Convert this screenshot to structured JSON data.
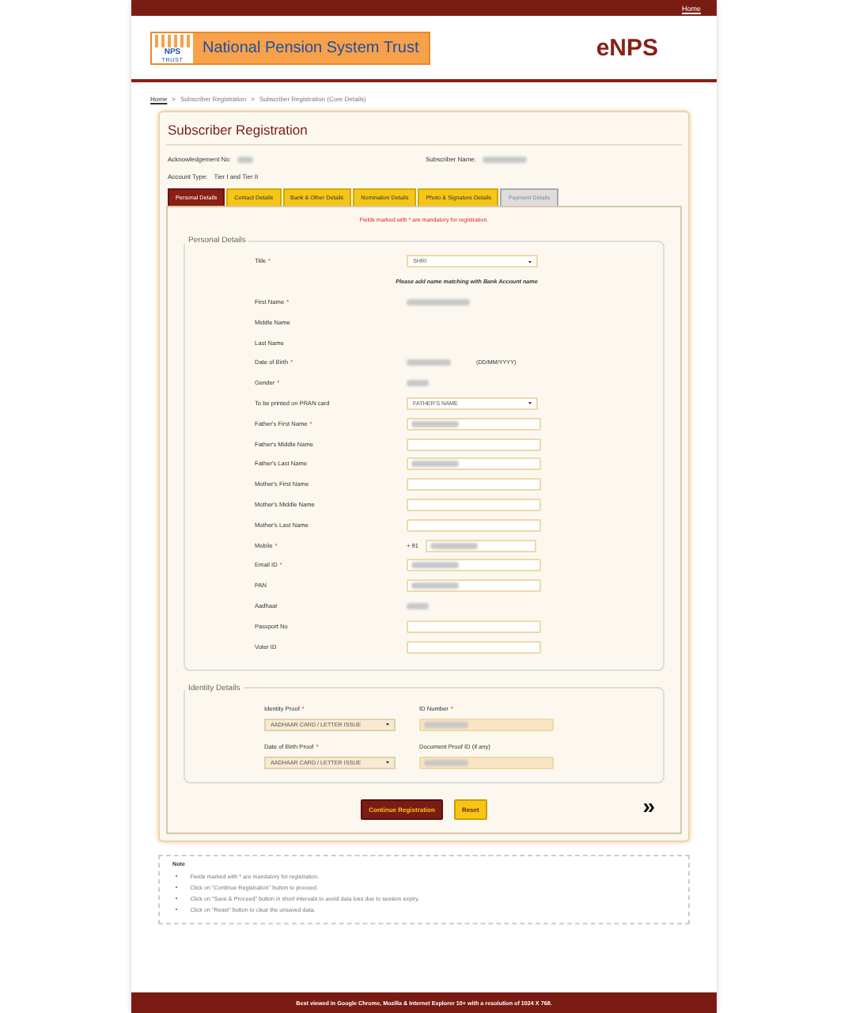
{
  "top_bar": {
    "link": "Home"
  },
  "header": {
    "logo_mark": "NPS",
    "logo_sub": "TRUST",
    "org_name": "National Pension System Trust",
    "brand": "eNPS"
  },
  "breadcrumb": [
    {
      "label": "Home",
      "link": true
    },
    {
      "label": "Subscriber Registration",
      "link": false
    },
    {
      "label": "Subscriber Registration (Core Details)",
      "link": false
    }
  ],
  "breadcrumb_separator": ">",
  "form": {
    "title": "Subscriber Registration",
    "info": [
      {
        "label": "Acknowledgement No:",
        "redacted": true
      },
      {
        "label": "Subscriber Name:",
        "redacted": true
      },
      {
        "label": "Account Type:",
        "value": "Tier I and Tier II"
      }
    ],
    "tabs": [
      {
        "label": "Personal Details",
        "selected": true,
        "disabled": false
      },
      {
        "label": "Contact Details",
        "selected": false,
        "disabled": false
      },
      {
        "label": "Bank & Other Details",
        "selected": false,
        "disabled": false
      },
      {
        "label": "Nomination Details",
        "selected": false,
        "disabled": false
      },
      {
        "label": "Photo & Signature Details",
        "selected": false,
        "disabled": false
      },
      {
        "label": "Payment Details",
        "selected": false,
        "disabled": true
      }
    ],
    "mandatory_note": "Fields marked with * are mandatory for registration.",
    "personal": {
      "legend": "Personal Details",
      "rows": [
        {
          "kind": "select",
          "label": "Title",
          "required_mark": "*",
          "value": "SHRI"
        },
        {
          "kind": "note",
          "text": "Please add name matching with Bank Account name"
        },
        {
          "kind": "static",
          "label": "First Name",
          "required_mark": "*",
          "redacted": true
        },
        {
          "kind": "static",
          "label": "Middle Name"
        },
        {
          "kind": "static",
          "label": "Last Name"
        },
        {
          "kind": "static",
          "label": "Date of Birth",
          "required_mark": "*",
          "redacted": true,
          "hint": "(DD/MM/YYYY)"
        },
        {
          "kind": "static",
          "label": "Gender",
          "required_mark": "*",
          "redacted": true
        },
        {
          "kind": "select",
          "label": "To be printed on PRAN card",
          "value": "FATHER'S NAME"
        },
        {
          "kind": "input",
          "label": "Father's First Name",
          "required_mark": "*",
          "redacted": true
        },
        {
          "kind": "input",
          "label": "Father's Middle Name"
        },
        {
          "kind": "input",
          "label": "Father's Last Name",
          "redacted": true
        },
        {
          "kind": "input",
          "label": "Mother's First Name"
        },
        {
          "kind": "input",
          "label": "Mother's Middle Name"
        },
        {
          "kind": "input",
          "label": "Mother's Last Name"
        },
        {
          "kind": "input",
          "label": "Mobile",
          "required_mark": "*",
          "prefix": "+ 91",
          "redacted": true
        },
        {
          "kind": "input",
          "label": "Email ID",
          "required_mark": "*",
          "redacted": true
        },
        {
          "kind": "input",
          "label": "PAN",
          "redacted": true
        },
        {
          "kind": "static",
          "label": "Aadhaar",
          "redacted": true
        },
        {
          "kind": "input",
          "label": "Passport No"
        },
        {
          "kind": "input",
          "label": "Voter ID"
        }
      ]
    },
    "identity": {
      "legend": "Identity Details",
      "rows": [
        [
          {
            "kind": "select",
            "label": "Identity Proof",
            "required_mark": "*",
            "value": "AADHAAR CARD / LETTER ISSUE",
            "disabled": true
          },
          {
            "kind": "input",
            "label": "ID Number",
            "required_mark": "*",
            "redacted": true,
            "disabled": true
          }
        ],
        [
          {
            "kind": "select",
            "label": "Date of Birth Proof",
            "required_mark": "*",
            "value": "AADHAAR CARD / LETTER ISSUE",
            "disabled": true
          },
          {
            "kind": "input",
            "label": "Document Proof ID (if any)",
            "redacted": true,
            "disabled": true
          }
        ]
      ]
    },
    "buttons": [
      {
        "label": "Continue Registration",
        "kind": "primary"
      },
      {
        "label": "Reset",
        "kind": "secondary"
      }
    ],
    "next": "»"
  },
  "notes": {
    "title": "Note",
    "items": [
      "Fields marked with * are mandatory for registration.",
      "Click on \"Continue Registration\" button to proceed.",
      "Click on \"Save & Proceed\" button in short intervals to avoid data loss due to session expiry.",
      "Click on \"Reset\" button to clear the unsaved data."
    ]
  },
  "footer": "Best viewed in Google Chrome, Mozilla & Internet Explorer 10+ with a resolution of 1024 X 768."
}
